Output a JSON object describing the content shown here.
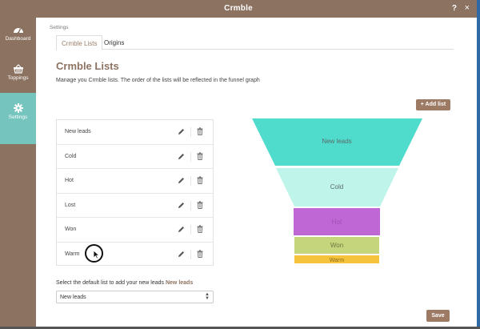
{
  "window": {
    "title": "Crmble",
    "help": "?",
    "close": "×"
  },
  "sidebar": {
    "items": [
      {
        "label": "Dashboard",
        "icon": "dashboard-icon"
      },
      {
        "label": "Toppings",
        "icon": "basket-icon"
      },
      {
        "label": "Settings",
        "icon": "gear-icon",
        "active": true
      }
    ]
  },
  "breadcrumb": "Settings",
  "tabs": [
    {
      "label": "Crmble Lists",
      "active": true
    },
    {
      "label": "Origins"
    }
  ],
  "heading": "Crmble Lists",
  "description": "Manage you Crmble lists. The order of the lists will be reflected in the funnel graph",
  "add_button": "+ Add list",
  "lists": [
    {
      "name": "New leads"
    },
    {
      "name": "Cold"
    },
    {
      "name": "Hot"
    },
    {
      "name": "Lost"
    },
    {
      "name": "Won"
    },
    {
      "name": "Warm"
    }
  ],
  "default_list": {
    "label": "Select the default list to add your new leads",
    "current": "New leads",
    "selected": "New leads"
  },
  "save_button": "Save",
  "funnel": {
    "segments": [
      {
        "label": "New leads",
        "color": "#4fdccd"
      },
      {
        "label": "Cold",
        "color": "#bff4ea"
      },
      {
        "label": "Hot",
        "color": "#c067d6"
      },
      {
        "label": "Won",
        "color": "#c5d57c"
      },
      {
        "label": "Warm",
        "color": "#f6c33d"
      }
    ]
  },
  "colors": {
    "brand": "#8c7260",
    "active": "#75c4be"
  }
}
